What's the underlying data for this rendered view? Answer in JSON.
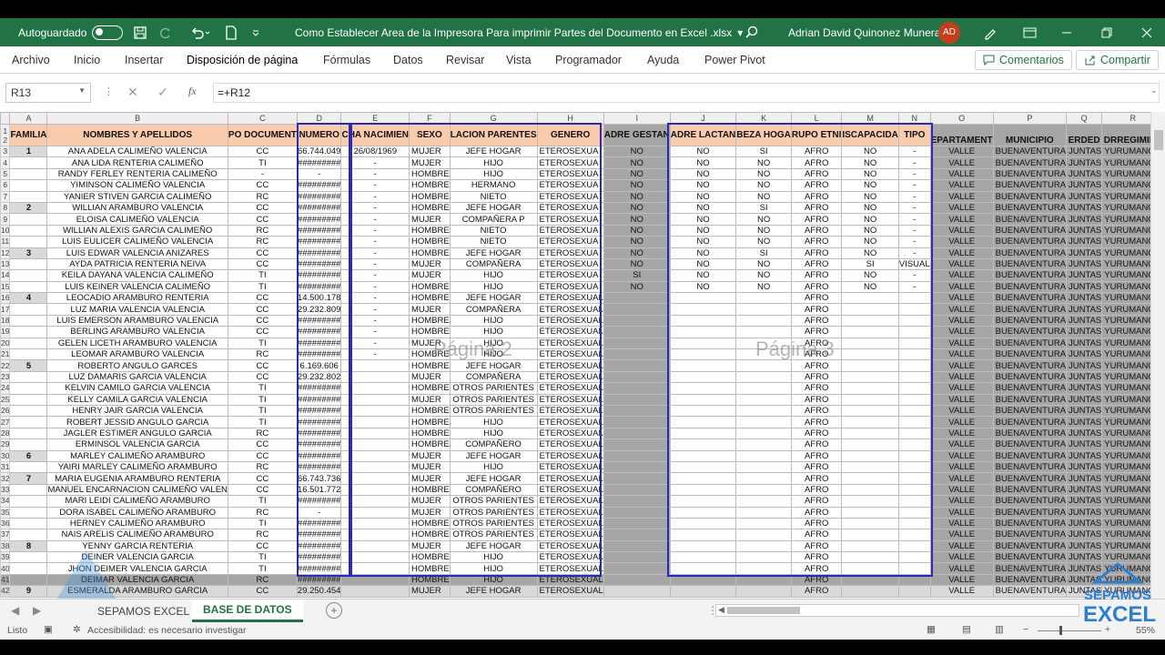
{
  "titlebar": {
    "autosave_label": "Autoguardado",
    "doc_title": "Como Establecer Area de la Impresora Para imprimir Partes del Documento en Excel .xlsx",
    "user_name": "Adrian David Quinonez Munera",
    "user_initials": "AD"
  },
  "ribbon": {
    "tabs": [
      "Archivo",
      "Inicio",
      "Insertar",
      "Disposición de página",
      "Fórmulas",
      "Datos",
      "Revisar",
      "Vista",
      "Programador",
      "Ayuda",
      "Power Pivot"
    ],
    "active_tab": "Disposición de página",
    "comments_label": "Comentarios",
    "share_label": "Compartir"
  },
  "formula": {
    "namebox": "R13",
    "fx_label": "fx",
    "value": "=+R12"
  },
  "columns": [
    "A",
    "B",
    "C",
    "D",
    "E",
    "F",
    "G",
    "H",
    "I",
    "J",
    "K",
    "L",
    "M",
    "N",
    "O",
    "P",
    "Q",
    "R"
  ],
  "headers": {
    "familia": "FAMILIA",
    "nombres": "NOMBRES Y APELLIDOS",
    "tipo_doc": "PO DOCUMENT",
    "numero": "NUMERO",
    "fecha": "CHA NACIMIEN",
    "sexo": "SEXO",
    "parentesco": "LACION PARENTES",
    "genero": "GENERO",
    "gestante": "ADRE GESTAN",
    "lactante": "ADRE LACTAN",
    "cabeza": "BEZA HOGA",
    "etnico": "RUPO ETNI",
    "discapacidad": "ISCAPACIDA",
    "tipo": "TIPO",
    "depto": "EPARTAMENT",
    "municipio": "MUNICIPIO",
    "vereda": "ERDED",
    "corregimiento": "DRREGIMIEN",
    "corner_D": "D"
  },
  "rows": [
    {
      "n": "3",
      "fam": "1",
      "name": "ANA ADELA CALIMEÑO VALENCIA",
      "doc": "CC",
      "num": "66.744.049",
      "fecha": "26/08/1969",
      "sexo": "MUJER",
      "par": "JEFE HOGAR",
      "gen": "ETEROSEXUA",
      "ges": "NO",
      "lac": "NO",
      "cab": "SI",
      "etn": "AFRO",
      "dis": "NO",
      "tipo": "-"
    },
    {
      "n": "4",
      "fam": "",
      "name": "ANA LIDA RENTERIA CALIMEÑO",
      "doc": "TI",
      "num": "#########",
      "fecha": "-",
      "sexo": "MUJER",
      "par": "HIJO",
      "gen": "ETEROSEXUA",
      "ges": "NO",
      "lac": "NO",
      "cab": "NO",
      "etn": "AFRO",
      "dis": "NO",
      "tipo": "-"
    },
    {
      "n": "5",
      "fam": "",
      "name": "RANDY FERLEY RENTERIA CALIMEÑO",
      "doc": "-",
      "num": "-",
      "fecha": "-",
      "sexo": "HOMBRE",
      "par": "HIJO",
      "gen": "ETEROSEXUA",
      "ges": "NO",
      "lac": "NO",
      "cab": "NO",
      "etn": "AFRO",
      "dis": "NO",
      "tipo": "-"
    },
    {
      "n": "6",
      "fam": "",
      "name": "YIMINSON CALIMEÑO VALENCIA",
      "doc": "CC",
      "num": "#########",
      "fecha": "-",
      "sexo": "HOMBRE",
      "par": "HERMANO",
      "gen": "ETEROSEXUA",
      "ges": "NO",
      "lac": "NO",
      "cab": "NO",
      "etn": "AFRO",
      "dis": "NO",
      "tipo": "-"
    },
    {
      "n": "7",
      "fam": "",
      "name": "YANIER STIVEN GARCIA CALIMEÑO",
      "doc": "RC",
      "num": "#########",
      "fecha": "-",
      "sexo": "HOMBRE",
      "par": "NIETO",
      "gen": "ETEROSEXUA",
      "ges": "NO",
      "lac": "NO",
      "cab": "NO",
      "etn": "AFRO",
      "dis": "NO",
      "tipo": "-"
    },
    {
      "n": "8",
      "fam": "2",
      "name": "WILLIAN ARAMBURO VALENCIA",
      "doc": "CC",
      "num": "#########",
      "fecha": "-",
      "sexo": "HOMBRE",
      "par": "JEFE HOGAR",
      "gen": "ETEROSEXUA",
      "ges": "NO",
      "lac": "NO",
      "cab": "SI",
      "etn": "AFRO",
      "dis": "NO",
      "tipo": "-"
    },
    {
      "n": "9",
      "fam": "",
      "name": "ELOISA CALIMEÑO VALENCIA",
      "doc": "CC",
      "num": "#########",
      "fecha": "-",
      "sexo": "MUJER",
      "par": "COMPAÑERA P",
      "gen": "ETEROSEXUA",
      "ges": "NO",
      "lac": "NO",
      "cab": "NO",
      "etn": "AFRO",
      "dis": "NO",
      "tipo": "-"
    },
    {
      "n": "10",
      "fam": "",
      "name": "WILLIAN ALEXIS GARCIA CALIMEÑO",
      "doc": "RC",
      "num": "#########",
      "fecha": "-",
      "sexo": "HOMBRE",
      "par": "NIETO",
      "gen": "ETEROSEXUA",
      "ges": "NO",
      "lac": "NO",
      "cab": "NO",
      "etn": "AFRO",
      "dis": "NO",
      "tipo": "-"
    },
    {
      "n": "11",
      "fam": "",
      "name": "LUIS EULICER CALIMEÑO VALENCIA",
      "doc": "RC",
      "num": "#########",
      "fecha": "-",
      "sexo": "HOMBRE",
      "par": "NIETO",
      "gen": "ETEROSEXUA",
      "ges": "NO",
      "lac": "NO",
      "cab": "NO",
      "etn": "AFRO",
      "dis": "NO",
      "tipo": "-"
    },
    {
      "n": "12",
      "fam": "3",
      "name": "LUIS EDWAR VALENCIA ANIZARES",
      "doc": "CC",
      "num": "#########",
      "fecha": "-",
      "sexo": "HOMBRE",
      "par": "JEFE HOGAR",
      "gen": "ETEROSEXUA",
      "ges": "NO",
      "lac": "NO",
      "cab": "SI",
      "etn": "AFRO",
      "dis": "NO",
      "tipo": "-"
    },
    {
      "n": "13",
      "fam": "",
      "name": "AYDA PATRICIA RENTERIA NEIVA",
      "doc": "CC",
      "num": "#########",
      "fecha": "-",
      "sexo": "MUJER",
      "par": "COMPAÑERA",
      "gen": "ETEROSEXUA",
      "ges": "NO",
      "lac": "NO",
      "cab": "NO",
      "etn": "AFRO",
      "dis": "SI",
      "tipo": "VISUAL"
    },
    {
      "n": "14",
      "fam": "",
      "name": "KEILA DAYANA VALENCIA CALIMEÑO",
      "doc": "TI",
      "num": "#########",
      "fecha": "-",
      "sexo": "MUJER",
      "par": "HIJO",
      "gen": "ETEROSEXUA",
      "ges": "SI",
      "lac": "NO",
      "cab": "NO",
      "etn": "AFRO",
      "dis": "NO",
      "tipo": "-"
    },
    {
      "n": "15",
      "fam": "",
      "name": "LUIS KEINER VALENCIA CALIMEÑO",
      "doc": "TI",
      "num": "#########",
      "fecha": "-",
      "sexo": "HOMBRE",
      "par": "HIJO",
      "gen": "ETEROSEXUA",
      "ges": "NO",
      "lac": "NO",
      "cab": "NO",
      "etn": "AFRO",
      "dis": "NO",
      "tipo": "-"
    },
    {
      "n": "16",
      "fam": "4",
      "name": "LEOCADIO ARAMBURO RENTERIA",
      "doc": "CC",
      "num": "14.500.178",
      "fecha": "-",
      "sexo": "HOMBRE",
      "par": "JEFE HOGAR",
      "gen": "ETEROSEXUAL",
      "ges": "",
      "lac": "",
      "cab": "",
      "etn": "AFRO",
      "dis": "",
      "tipo": ""
    },
    {
      "n": "17",
      "fam": "",
      "name": "LUZ MARIA VALENCIA VALENCIA",
      "doc": "CC",
      "num": "29.232.809",
      "fecha": "-",
      "sexo": "MUJER",
      "par": "COMPAÑERA",
      "gen": "ETEROSEXUAL",
      "ges": "",
      "lac": "",
      "cab": "",
      "etn": "AFRO",
      "dis": "",
      "tipo": ""
    },
    {
      "n": "18",
      "fam": "",
      "name": "LUIS EMERSON ARAMBURO VALENCIA",
      "doc": "CC",
      "num": "#########",
      "fecha": "-",
      "sexo": "HOMBRE",
      "par": "HIJO",
      "gen": "ETEROSEXUAL",
      "ges": "",
      "lac": "",
      "cab": "",
      "etn": "AFRO",
      "dis": "",
      "tipo": ""
    },
    {
      "n": "19",
      "fam": "",
      "name": "BERLING ARAMBURO VALENCIA",
      "doc": "CC",
      "num": "#########",
      "fecha": "-",
      "sexo": "HOMBRE",
      "par": "HIJO",
      "gen": "ETEROSEXUAL",
      "ges": "",
      "lac": "",
      "cab": "",
      "etn": "AFRO",
      "dis": "",
      "tipo": ""
    },
    {
      "n": "20",
      "fam": "",
      "name": "GELEN LICETH ARAMBURO VALENCIA",
      "doc": "TI",
      "num": "#########",
      "fecha": "-",
      "sexo": "MUJER",
      "par": "HIJO",
      "gen": "ETEROSEXUAL",
      "ges": "",
      "lac": "",
      "cab": "",
      "etn": "AFRO",
      "dis": "",
      "tipo": ""
    },
    {
      "n": "21",
      "fam": "",
      "name": "LEOMAR ARAMBURO VALENCIA",
      "doc": "RC",
      "num": "#########",
      "fecha": "-",
      "sexo": "HOMBRE",
      "par": "HIJO",
      "gen": "ETEROSEXUAL",
      "ges": "",
      "lac": "",
      "cab": "",
      "etn": "AFRO",
      "dis": "",
      "tipo": ""
    },
    {
      "n": "22",
      "fam": "5",
      "name": "ROBERTO ANGULO GARCES",
      "doc": "CC",
      "num": "6.169.606",
      "fecha": "",
      "sexo": "HOMBRE",
      "par": "JEFE HOGAR",
      "gen": "ETEROSEXUAL",
      "ges": "",
      "lac": "",
      "cab": "",
      "etn": "AFRO",
      "dis": "",
      "tipo": ""
    },
    {
      "n": "23",
      "fam": "",
      "name": "LUZ DAMARIS GARCIA VALENCIA",
      "doc": "CC",
      "num": "29.232.802",
      "fecha": "",
      "sexo": "MUJER",
      "par": "COMPAÑERA",
      "gen": "ETEROSEXUAL",
      "ges": "",
      "lac": "",
      "cab": "",
      "etn": "AFRO",
      "dis": "",
      "tipo": ""
    },
    {
      "n": "24",
      "fam": "",
      "name": "KELVIN CAMILO GARCIA VALENCIA",
      "doc": "TI",
      "num": "#########",
      "fecha": "",
      "sexo": "HOMBRE",
      "par": "OTROS PARIENTES",
      "gen": "ETEROSEXUAL",
      "ges": "",
      "lac": "",
      "cab": "",
      "etn": "AFRO",
      "dis": "",
      "tipo": ""
    },
    {
      "n": "25",
      "fam": "",
      "name": "KELLY CAMILA GARCIA VALENCIA",
      "doc": "TI",
      "num": "#########",
      "fecha": "",
      "sexo": "MUJER",
      "par": "OTROS PARIENTES",
      "gen": "ETEROSEXUAL",
      "ges": "",
      "lac": "",
      "cab": "",
      "etn": "AFRO",
      "dis": "",
      "tipo": ""
    },
    {
      "n": "26",
      "fam": "",
      "name": "HENRY JAIR GARCIA VALENCIA",
      "doc": "TI",
      "num": "#########",
      "fecha": "",
      "sexo": "HOMBRE",
      "par": "OTROS PARIENTES",
      "gen": "ETEROSEXUAL",
      "ges": "",
      "lac": "",
      "cab": "",
      "etn": "AFRO",
      "dis": "",
      "tipo": ""
    },
    {
      "n": "27",
      "fam": "",
      "name": "ROBERT JESSID ANGULO GARCIA",
      "doc": "TI",
      "num": "#########",
      "fecha": "",
      "sexo": "HOMBRE",
      "par": "HIJO",
      "gen": "ETEROSEXUAL",
      "ges": "",
      "lac": "",
      "cab": "",
      "etn": "AFRO",
      "dis": "",
      "tipo": ""
    },
    {
      "n": "28",
      "fam": "",
      "name": "JAGLER ESTIMER ANGULO GARCIA",
      "doc": "RC",
      "num": "#########",
      "fecha": "",
      "sexo": "HOMBRE",
      "par": "HIJO",
      "gen": "ETEROSEXUAL",
      "ges": "",
      "lac": "",
      "cab": "",
      "etn": "AFRO",
      "dis": "",
      "tipo": ""
    },
    {
      "n": "29",
      "fam": "",
      "name": "ERMINSOL VALENCIA GARCIA",
      "doc": "CC",
      "num": "#########",
      "fecha": "",
      "sexo": "HOMBRE",
      "par": "COMPAÑERO",
      "gen": "ETEROSEXUAL",
      "ges": "",
      "lac": "",
      "cab": "",
      "etn": "AFRO",
      "dis": "",
      "tipo": ""
    },
    {
      "n": "30",
      "fam": "6",
      "name": "MARLEY CALIMEÑO ARAMBURO",
      "doc": "CC",
      "num": "#########",
      "fecha": "",
      "sexo": "MUJER",
      "par": "JEFE HOGAR",
      "gen": "ETEROSEXUAL",
      "ges": "",
      "lac": "",
      "cab": "",
      "etn": "AFRO",
      "dis": "",
      "tipo": ""
    },
    {
      "n": "31",
      "fam": "",
      "name": "YAIRI MARLEY CALIMEÑO ARAMBURO",
      "doc": "RC",
      "num": "#########",
      "fecha": "",
      "sexo": "MUJER",
      "par": "HIJO",
      "gen": "ETEROSEXUAL",
      "ges": "",
      "lac": "",
      "cab": "",
      "etn": "AFRO",
      "dis": "",
      "tipo": ""
    },
    {
      "n": "32",
      "fam": "7",
      "name": "MARIA EUGENIA ARAMBURO RENTERIA",
      "doc": "CC",
      "num": "66.743.736",
      "fecha": "",
      "sexo": "MUJER",
      "par": "JEFE HOGAR",
      "gen": "ETEROSEXUAL",
      "ges": "",
      "lac": "",
      "cab": "",
      "etn": "AFRO",
      "dis": "",
      "tipo": ""
    },
    {
      "n": "33",
      "fam": "",
      "name": "MANUEL ENCARNACION CALIMEÑO VALEN",
      "doc": "CC",
      "num": "16.501.772",
      "fecha": "",
      "sexo": "HOMBRE",
      "par": "COMPAÑERO",
      "gen": "ETEROSEXUAL",
      "ges": "",
      "lac": "",
      "cab": "",
      "etn": "AFRO",
      "dis": "",
      "tipo": ""
    },
    {
      "n": "34",
      "fam": "",
      "name": "MARI LEIDI CALIMEÑO ARAMBURO",
      "doc": "TI",
      "num": "#########",
      "fecha": "",
      "sexo": "MUJER",
      "par": "OTROS PARIENTES",
      "gen": "ETEROSEXUAL",
      "ges": "",
      "lac": "",
      "cab": "",
      "etn": "AFRO",
      "dis": "",
      "tipo": ""
    },
    {
      "n": "35",
      "fam": "",
      "name": "DORA ISABEL CALIMEÑO ARAMBURO",
      "doc": "RC",
      "num": "-",
      "fecha": "",
      "sexo": "MUJER",
      "par": "OTROS PARIENTES",
      "gen": "ETEROSEXUAL",
      "ges": "",
      "lac": "",
      "cab": "",
      "etn": "AFRO",
      "dis": "",
      "tipo": ""
    },
    {
      "n": "36",
      "fam": "",
      "name": "HERNEY CALIMEÑO ARAMBURO",
      "doc": "TI",
      "num": "#########",
      "fecha": "",
      "sexo": "HOMBRE",
      "par": "OTROS PARIENTES",
      "gen": "ETEROSEXUAL",
      "ges": "",
      "lac": "",
      "cab": "",
      "etn": "AFRO",
      "dis": "",
      "tipo": ""
    },
    {
      "n": "37",
      "fam": "",
      "name": "NAIS ARELIS CALIMEÑO ARAMBURO",
      "doc": "RC",
      "num": "#########",
      "fecha": "",
      "sexo": "HOMBRE",
      "par": "OTROS PARIENTES",
      "gen": "ETEROSEXUAL",
      "ges": "",
      "lac": "",
      "cab": "",
      "etn": "AFRO",
      "dis": "",
      "tipo": ""
    },
    {
      "n": "38",
      "fam": "8",
      "name": "YENNY GARCIA RENTERIA",
      "doc": "CC",
      "num": "#########",
      "fecha": "",
      "sexo": "MUJER",
      "par": "JEFE HOGAR",
      "gen": "ETEROSEXUAL",
      "ges": "",
      "lac": "",
      "cab": "",
      "etn": "AFRO",
      "dis": "",
      "tipo": ""
    },
    {
      "n": "39",
      "fam": "",
      "name": "DEINER VALENCIA GARCIA",
      "doc": "TI",
      "num": "#########",
      "fecha": "",
      "sexo": "HOMBRE",
      "par": "HIJO",
      "gen": "ETEROSEXUAL",
      "ges": "",
      "lac": "",
      "cab": "",
      "etn": "AFRO",
      "dis": "",
      "tipo": ""
    },
    {
      "n": "40",
      "fam": "",
      "name": "JHON DEIMER VALENCIA GARCIA",
      "doc": "TI",
      "num": "#########",
      "fecha": "",
      "sexo": "HOMBRE",
      "par": "HIJO",
      "gen": "ETEROSEXUAL",
      "ges": "",
      "lac": "",
      "cab": "",
      "etn": "AFRO",
      "dis": "",
      "tipo": ""
    },
    {
      "n": "41",
      "fam": "",
      "name": "DEIMAR VALENCIA GARCIA",
      "doc": "RC",
      "num": "#########",
      "fecha": "",
      "sexo": "HOMBRE",
      "par": "HIJO",
      "gen": "ETEROSEXUAL",
      "ges": "",
      "lac": "",
      "cab": "",
      "etn": "AFRO",
      "dis": "",
      "tipo": ""
    },
    {
      "n": "42",
      "fam": "9",
      "name": "ESMERALDA ARAMBURO GARCIA",
      "doc": "CC",
      "num": "29.250.454",
      "fecha": "",
      "sexo": "MUJER",
      "par": "JEFE HOGAR",
      "gen": "ETEROSEXUAL",
      "ges": "",
      "lac": "",
      "cab": "",
      "etn": "AFRO",
      "dis": "",
      "tipo": ""
    }
  ],
  "right_block": {
    "depto": "VALLE",
    "municipio": "BUENAVENTURA",
    "vereda": "JUNTAS",
    "corregimiento": "YURUMANGUI"
  },
  "watermarks": {
    "page2": "Página 2",
    "page3": "Página 3"
  },
  "sheets": {
    "tabs": [
      "SEPAMOS EXCEL",
      "BASE DE DATOS"
    ],
    "active": "BASE DE DATOS"
  },
  "status": {
    "ready": "Listo",
    "accessibility": "Accesibilidad: es necesario investigar",
    "zoom": "55%"
  },
  "logo": {
    "line1": "SEPAMOS",
    "line2": "EXCEL"
  },
  "colors": {
    "excel_green": "#217346",
    "header_fill": "#f8cbad",
    "gray_fill": "#a6a6a6",
    "page_border": "#2a2ab8"
  }
}
